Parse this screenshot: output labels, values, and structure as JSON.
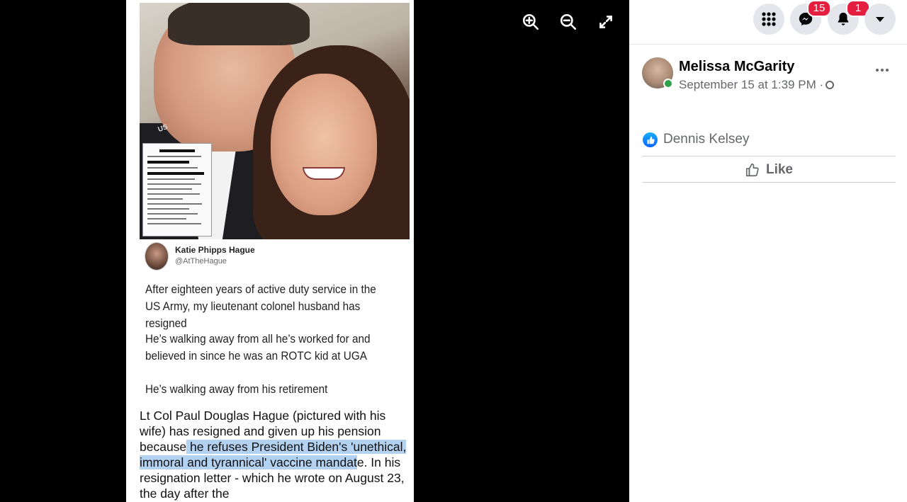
{
  "viewer": {
    "tweet": {
      "name": "Katie Phipps Hague",
      "handle": "@AtTheHague",
      "para1": "After eighteen years of active duty service in the US Army, my lieutenant colonel husband has resigned",
      "para2": "He’s walking away from all he’s worked for and believed in since he was an ROTC kid at UGA",
      "para3": "He’s walking away from his retirement"
    },
    "photo_label": "US",
    "article": {
      "before": "Lt Col Paul Douglas Hague (pictured with his wife) has resigned and given up his pension because",
      "highlight": " he refuses President Biden's 'unethical, immoral and tyrannical' vaccine mandat",
      "after": "e. In his resignation letter - which he wrote on August 23, the day after the"
    },
    "controls": {
      "zoom_in": "zoom-in-icon",
      "zoom_out": "zoom-out-icon",
      "fullscreen": "fullscreen-icon"
    }
  },
  "topbar": {
    "messenger_badge": "15",
    "notifications_badge": "1"
  },
  "post": {
    "author": "Melissa McGarity",
    "time": "September 15 at 1:39 PM ·",
    "reactions": {
      "name": "Dennis Kelsey"
    },
    "like_label": "Like"
  },
  "colors": {
    "facebook_blue": "#0866ff",
    "badge_red": "#e41e3f",
    "online_green": "#31a24c"
  }
}
